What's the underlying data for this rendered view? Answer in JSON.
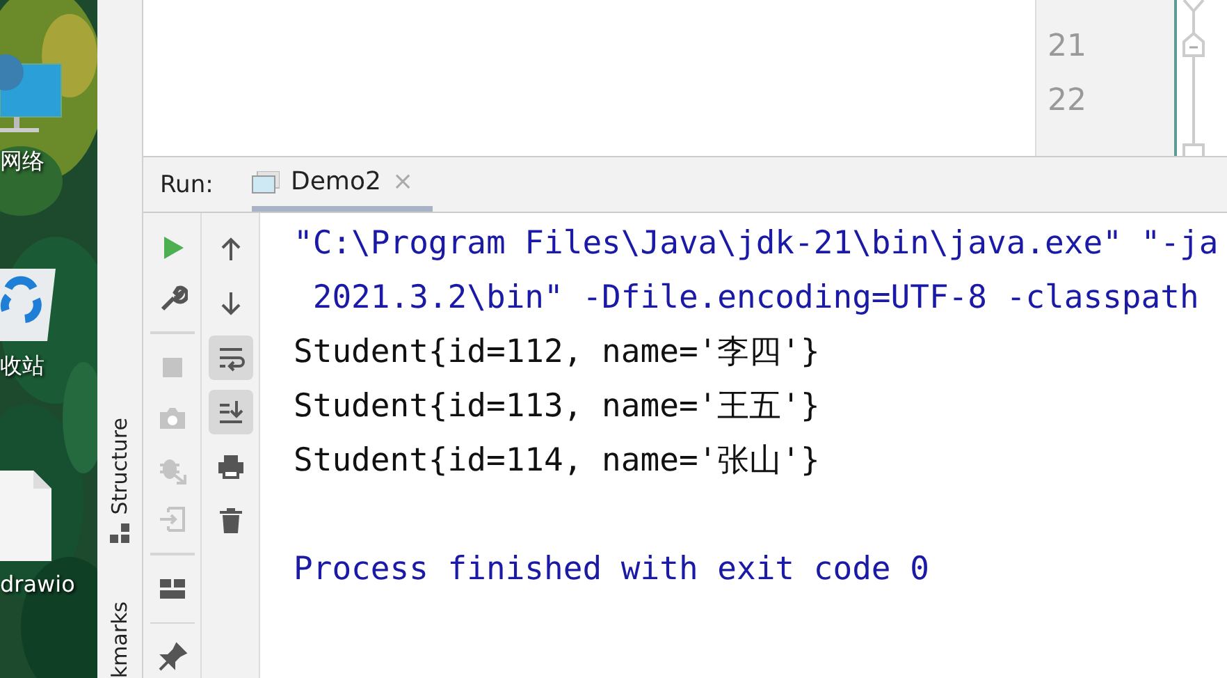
{
  "desktop": {
    "icons": [
      {
        "kind": "network",
        "label": "网络"
      },
      {
        "kind": "recycle",
        "label": "收站"
      },
      {
        "kind": "file",
        "label": "drawio"
      }
    ]
  },
  "side_stripe": {
    "items": [
      {
        "label": "Structure"
      },
      {
        "label": "kmarks"
      }
    ]
  },
  "editor": {
    "line_numbers": [
      "21",
      "22"
    ]
  },
  "run_panel": {
    "title": "Run:",
    "tabs": [
      {
        "label": "Demo2",
        "selected": true,
        "close": "×"
      }
    ],
    "left_toolbar": [
      {
        "kind": "run",
        "disabled": false
      },
      {
        "kind": "wrench",
        "disabled": false
      },
      {
        "kind": "separator"
      },
      {
        "kind": "stop",
        "disabled": true
      },
      {
        "kind": "camera",
        "disabled": true
      },
      {
        "kind": "bug",
        "disabled": true
      },
      {
        "kind": "login",
        "disabled": true
      },
      {
        "kind": "separator"
      },
      {
        "kind": "layout",
        "disabled": false
      },
      {
        "kind": "separator"
      },
      {
        "kind": "pin",
        "disabled": false
      }
    ],
    "right_toolbar": [
      {
        "kind": "up",
        "on": false
      },
      {
        "kind": "down",
        "on": false
      },
      {
        "kind": "wrap",
        "on": true
      },
      {
        "kind": "scroll-end",
        "on": true
      },
      {
        "kind": "print",
        "on": false
      },
      {
        "kind": "trash",
        "on": false
      }
    ],
    "console": [
      {
        "kind": "system",
        "text": "\"C:\\Program Files\\Java\\jdk-21\\bin\\java.exe\" \"-ja"
      },
      {
        "kind": "system",
        "text": " 2021.3.2\\bin\" -Dfile.encoding=UTF-8 -classpath"
      },
      {
        "kind": "output",
        "text": "Student{id=112, name='李四'}"
      },
      {
        "kind": "output",
        "text": "Student{id=113, name='王五'}"
      },
      {
        "kind": "output",
        "text": "Student{id=114, name='张山'}"
      },
      {
        "kind": "blank"
      },
      {
        "kind": "system",
        "text": "Process finished with exit code 0"
      }
    ]
  }
}
